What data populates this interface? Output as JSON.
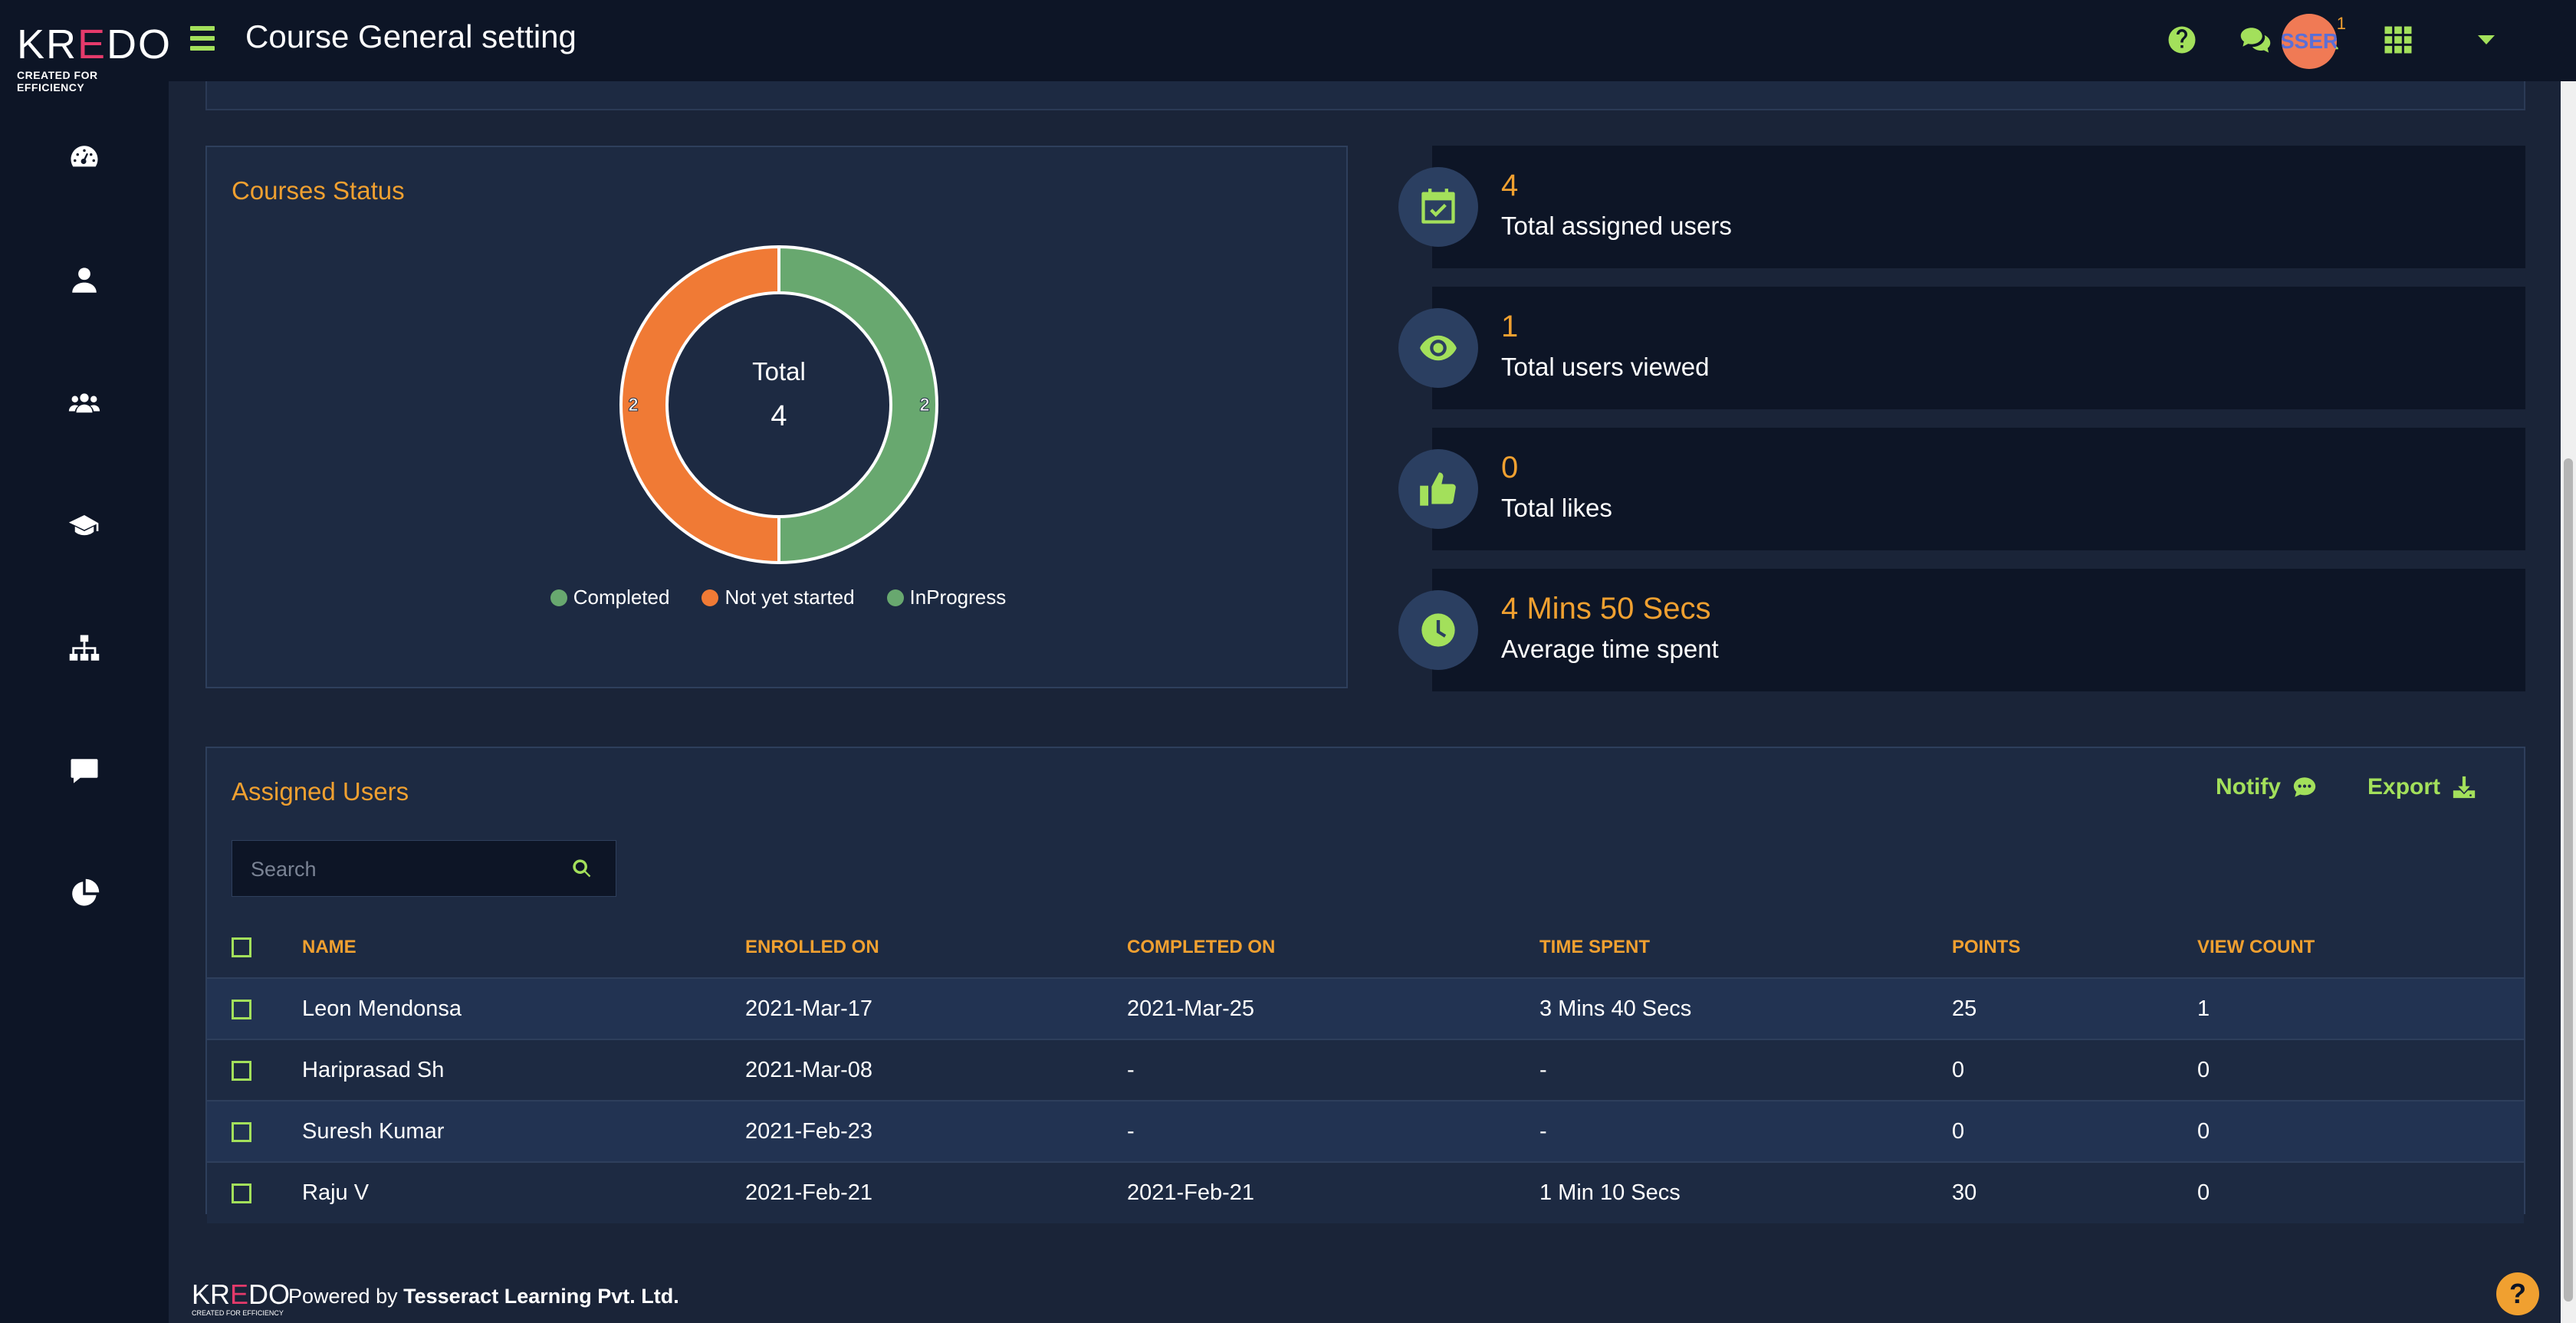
{
  "app": {
    "logo_text_pre": "KR",
    "logo_text_e": "E",
    "logo_text_post": "DO",
    "logo_tagline": "CREATED FOR EFFICIENCY"
  },
  "header": {
    "title": "Course General setting",
    "notification_count": "1",
    "avatar_text": "SSER"
  },
  "sidebar": {
    "items": [
      "dashboard-icon",
      "user-icon",
      "users-group-icon",
      "graduation-cap-icon",
      "sitemap-icon",
      "comment-icon",
      "pie-chart-icon"
    ]
  },
  "courses_status": {
    "title": "Courses Status",
    "center_label": "Total",
    "center_value": "4"
  },
  "chart_data": {
    "type": "pie",
    "categories": [
      "Completed",
      "Not yet started",
      "InProgress"
    ],
    "values": [
      0,
      2,
      2
    ],
    "colors": [
      "#68a86f",
      "#f07a35",
      "#68a86f"
    ],
    "center_label": "Total",
    "center_value": 4,
    "slice_labels": [
      "2",
      "2"
    ],
    "legend_placement": "bottom"
  },
  "stats": [
    {
      "value": "4",
      "label": "Total assigned users",
      "icon": "calendar-check-icon"
    },
    {
      "value": "1",
      "label": "Total users viewed",
      "icon": "eye-icon"
    },
    {
      "value": "0",
      "label": "Total likes",
      "icon": "thumbs-up-icon"
    },
    {
      "value": "4 Mins 50 Secs",
      "label": "Average time spent",
      "icon": "clock-icon"
    }
  ],
  "assigned_users": {
    "title": "Assigned Users",
    "notify_label": "Notify",
    "export_label": "Export",
    "search_placeholder": "Search",
    "columns": [
      "NAME",
      "ENROLLED ON",
      "COMPLETED ON",
      "TIME SPENT",
      "POINTS",
      "VIEW COUNT"
    ],
    "rows": [
      {
        "name": "Leon Mendonsa",
        "enrolled": "2021-Mar-17",
        "completed": "2021-Mar-25",
        "time_spent": "3 Mins 40 Secs",
        "points": "25",
        "view_count": "1"
      },
      {
        "name": "Haripras­ad Sh",
        "enrolled": "2021-Mar-08",
        "completed": "-",
        "time_spent": "-",
        "points": "0",
        "view_count": "0"
      },
      {
        "name": "Suresh Kumar",
        "enrolled": "2021-Feb-23",
        "completed": "-",
        "time_spent": "-",
        "points": "0",
        "view_count": "0"
      },
      {
        "name": "Raju V",
        "enrolled": "2021-Feb-21",
        "completed": "2021-Feb-21",
        "time_spent": "1 Min 10 Secs",
        "points": "30",
        "view_count": "0"
      }
    ]
  },
  "footer": {
    "logo_pre": "KR",
    "logo_e": "E",
    "logo_post": "DO",
    "logo_tagline": "CREATED FOR EFFICIENCY",
    "powered_by": "Powered by",
    "company": "Tesseract Learning Pvt. Ltd.",
    "help": "?"
  }
}
